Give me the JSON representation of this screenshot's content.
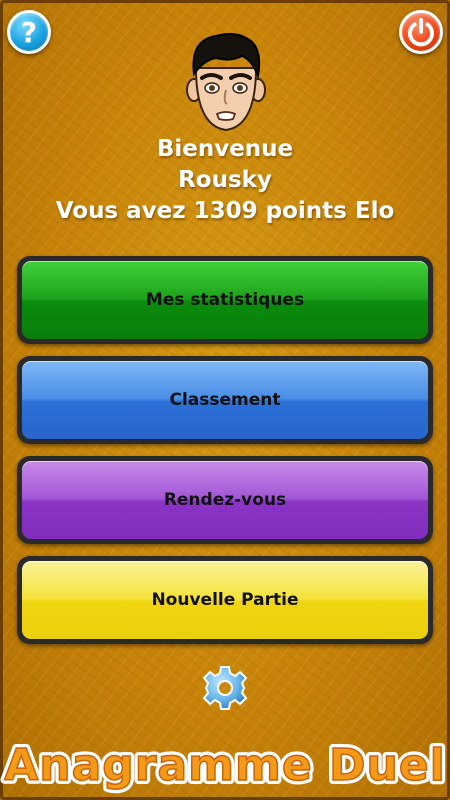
{
  "header": {
    "help_icon": "question-mark",
    "power_icon": "power",
    "help_glyph": "?",
    "colors": {
      "help": "#1aa2e0",
      "power": "#f04516"
    }
  },
  "welcome": {
    "line1": "Bienvenue",
    "name": "Rousky",
    "elo_text": "Vous avez 1309 points Elo"
  },
  "menu": {
    "stats_label": "Mes statistiques",
    "ranking_label": "Classement",
    "appointment_label": "Rendez-vous",
    "new_game_label": "Nouvelle Partie",
    "colors": {
      "stats": "#1ea31c",
      "ranking": "#2c70d8",
      "appointment": "#8a34c6",
      "new_game": "#f0d512"
    }
  },
  "footer": {
    "settings_icon": "gear",
    "app_title": "Anagramme Duel"
  },
  "theme": {
    "background": "#c78309",
    "title_fill": "#f39a18",
    "title_stroke": "#ffffff"
  }
}
